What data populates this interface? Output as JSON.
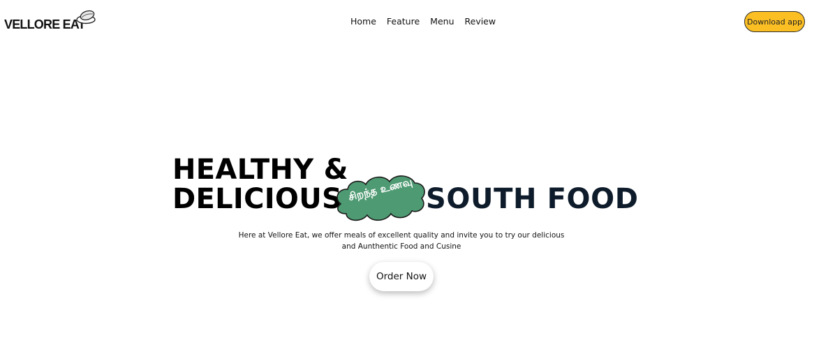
{
  "header": {
    "logo_text": "VELLORE EAT",
    "logo_icon": "dosa-plate-icon",
    "nav": [
      {
        "label": "Home"
      },
      {
        "label": "Feature"
      },
      {
        "label": "Menu"
      },
      {
        "label": "Review"
      }
    ],
    "download_label": "Download app"
  },
  "hero": {
    "line1": "HEALTHY &",
    "line2": "DELICIOUS",
    "accent": "SOUTH FOOD",
    "badge_text": "சிறந்த உணவு",
    "tagline_1": "Here at Vellore Eat, we offer meals of excellent quality and invite you to try our delicious",
    "tagline_2": "and Aunthentic Food and Cusine",
    "cta_label": "Order Now"
  },
  "colors": {
    "download_button": "#fbbf24",
    "badge_fill": "#4e9a72",
    "accent_text": "#0d1b2a"
  }
}
